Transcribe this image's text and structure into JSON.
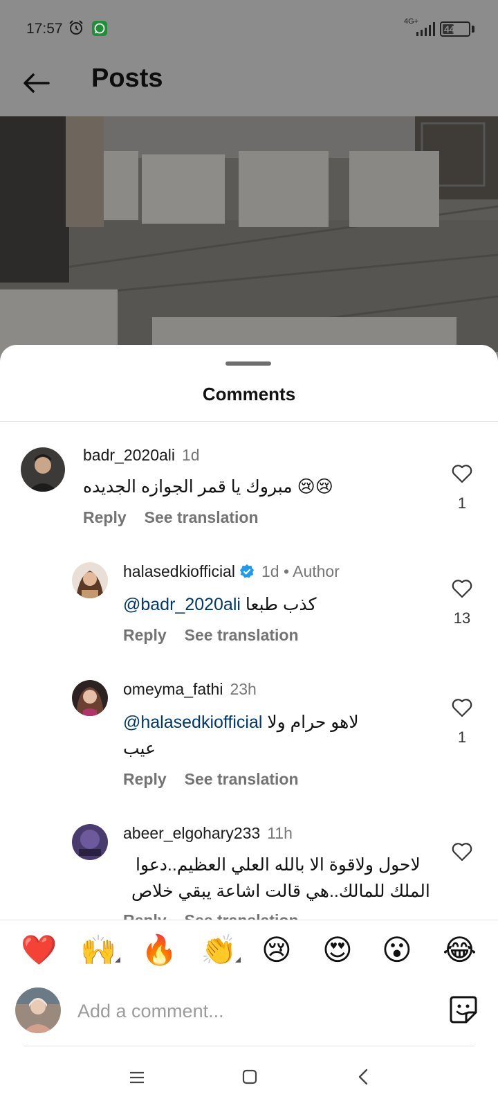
{
  "status_bar": {
    "time": "17:57",
    "network": "4G+",
    "battery": "44",
    "battery_level_percent": 44
  },
  "header": {
    "title": "Posts"
  },
  "sheet": {
    "title": "Comments"
  },
  "comments": [
    {
      "username": "badr_2020ali",
      "meta": "1d",
      "text": "مبروك يا قمر الجوازه الجديده 😢😢",
      "reply_label": "Reply",
      "translate_label": "See translation",
      "likes": "1"
    },
    {
      "username": "halasedkiofficial",
      "meta": "1d • Author",
      "verified": true,
      "mention": "@badr_2020ali",
      "text": "كذب طبعا",
      "reply_label": "Reply",
      "translate_label": "See translation",
      "likes": "13"
    },
    {
      "username": "omeyma_fathi",
      "meta": "23h",
      "mention": "@halasedkiofficial",
      "text": "لاهو حرام ولا",
      "text_line2": "عيب",
      "reply_label": "Reply",
      "translate_label": "See translation",
      "likes": "1"
    },
    {
      "username": "abeer_elgohary233",
      "meta": "11h",
      "text": "لاحول ولاقوة الا بالله العلي العظيم..دعوا",
      "text_line2": "الملك للمالك..هي قالت اشاعة يبقي خلاص",
      "reply_label": "Reply",
      "translate_label": "See translation"
    }
  ],
  "emoji_bar": [
    "❤️",
    "🙌",
    "🔥",
    "👏",
    "😢",
    "😍",
    "😮",
    "😂"
  ],
  "composer": {
    "placeholder": "Add a comment..."
  },
  "colors": {
    "mention": "#00376b",
    "heart_red": "#e0202e",
    "verified_blue": "#1d9bf0",
    "secondary_text": "#737373"
  },
  "icons": {
    "back": "back-arrow-icon",
    "alarm": "alarm-clock-icon",
    "whatsapp": "whatsapp-icon",
    "like": "heart-outline-icon",
    "sticker": "sticker-icon",
    "nav_menu": "menu-icon",
    "nav_home": "square-home-icon",
    "nav_back": "chevron-left-icon"
  }
}
